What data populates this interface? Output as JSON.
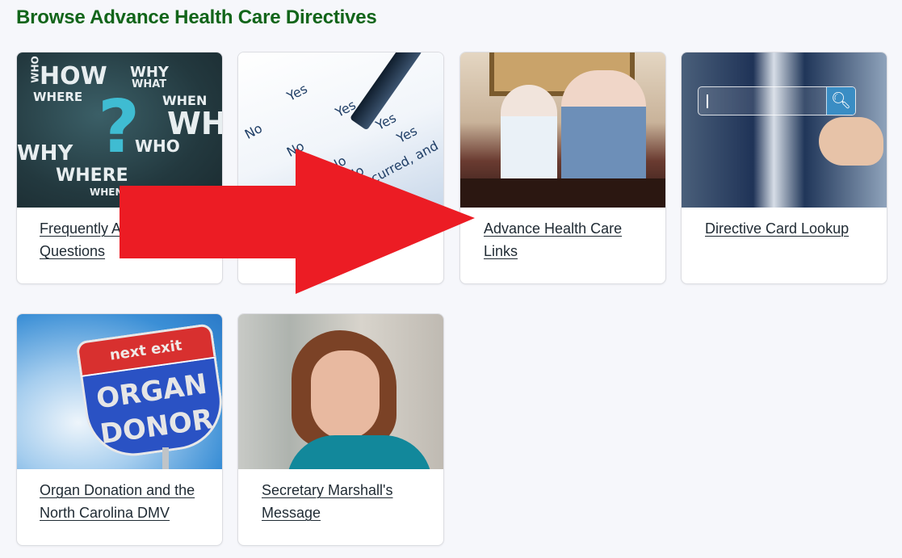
{
  "page": {
    "title": "Browse Advance Health Care Directives",
    "title_color": "#12651a",
    "link_color": "#1f2a33",
    "background": "#f6f7fb"
  },
  "cards": [
    {
      "link": "Frequently Asked Questions",
      "visible_link_lines": [
        "Frequently A",
        "Questions"
      ],
      "image": "question-words-chalkboard-image",
      "image_words": [
        "HOW",
        "WHY",
        "WHAT",
        "WHERE",
        "WHEN",
        "WHO",
        "WHA"
      ]
    },
    {
      "link": "",
      "image": "checklist-form-pen-image",
      "image_words": [
        "Yes",
        "No",
        "Yes",
        "No",
        "Yes",
        "Yes",
        "No",
        "No",
        "curred, and"
      ]
    },
    {
      "link": "Advance Health Care Links",
      "image": "elderly-couple-signing-image"
    },
    {
      "link": "Directive Card Lookup",
      "image": "search-bar-touch-image"
    },
    {
      "link": "Organ Donation and the North Carolina DMV",
      "image": "organ-donor-sign-image",
      "sign_top": "next exit",
      "sign_bottom": "ORGAN DONOR"
    },
    {
      "link": "Secretary Marshall's Message",
      "image": "secretary-portrait-image"
    }
  ],
  "annotation": {
    "type": "arrow",
    "color": "#ec1c24",
    "direction": "right",
    "points_to": "Advance Health Care Links"
  }
}
